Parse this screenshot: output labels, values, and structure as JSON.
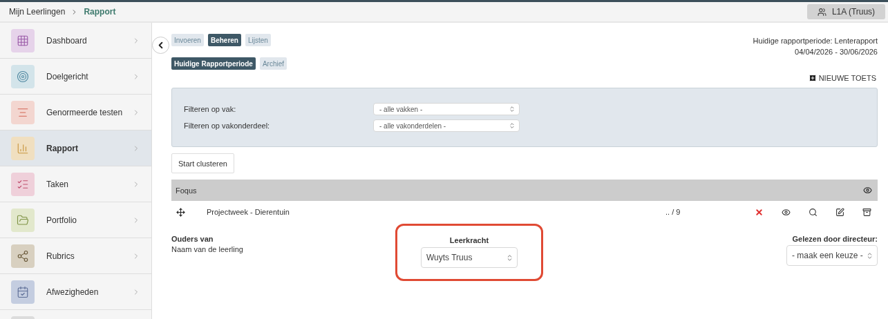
{
  "breadcrumb": [
    {
      "label": "Mijn Leerlingen",
      "current": false
    },
    {
      "label": "Rapport",
      "current": true
    }
  ],
  "class_button": {
    "label": "L1A (Truus)"
  },
  "sidebar": {
    "items": [
      {
        "label": "Dashboard",
        "kind": "grid",
        "color": "#e6d3ea",
        "selected": false
      },
      {
        "label": "Doelgericht",
        "kind": "target",
        "color": "#d3e4ea",
        "selected": false
      },
      {
        "label": "Genormeerde testen",
        "kind": "lines",
        "color": "#f3d6d0",
        "selected": false
      },
      {
        "label": "Rapport",
        "kind": "chart",
        "color": "#f0dfc0",
        "selected": true
      },
      {
        "label": "Taken",
        "kind": "checklist",
        "color": "#efd0da",
        "selected": false
      },
      {
        "label": "Portfolio",
        "kind": "folder",
        "color": "#e2e8cc",
        "selected": false
      },
      {
        "label": "Rubrics",
        "kind": "share",
        "color": "#d8d0c0",
        "selected": false
      },
      {
        "label": "Afwezigheden",
        "kind": "calendar",
        "color": "#c4cde0",
        "selected": false
      },
      {
        "kind": "blank",
        "color": "#dcdcdc",
        "selected": false
      }
    ]
  },
  "tabs": [
    {
      "label": "Invoeren",
      "selected": false
    },
    {
      "label": "Beheren",
      "selected": true
    },
    {
      "label": "Lijsten",
      "selected": false
    }
  ],
  "period_tabs": [
    {
      "label": "Huidige Rapportperiode",
      "selected": true
    },
    {
      "label": "Archief",
      "selected": false
    }
  ],
  "period": {
    "label": "Huidige rapportperiode: Lenterapport",
    "dates": "04/04/2026 - 30/06/2026"
  },
  "new_test": "NIEUWE TOETS",
  "filters": [
    {
      "label": "Filteren op vak:",
      "value": "- alle vakken -"
    },
    {
      "label": "Filteren op vakonderdeel:",
      "value": "- alle vakonderdelen -"
    }
  ],
  "cluster_button": "Start clusteren",
  "table": {
    "title": "Foqus",
    "rows": [
      {
        "name": "Projectweek - Dierentuin",
        "score": ".. / 9"
      }
    ]
  },
  "footer": {
    "parents": {
      "title": "Ouders van",
      "name": "Naam van de leerling"
    },
    "teacher": {
      "title": "Leerkracht",
      "value": "Wuyts Truus",
      "highlighted": true
    },
    "director": {
      "title": "Gelezen door directeur:",
      "value": "- maak een keuze -"
    }
  }
}
